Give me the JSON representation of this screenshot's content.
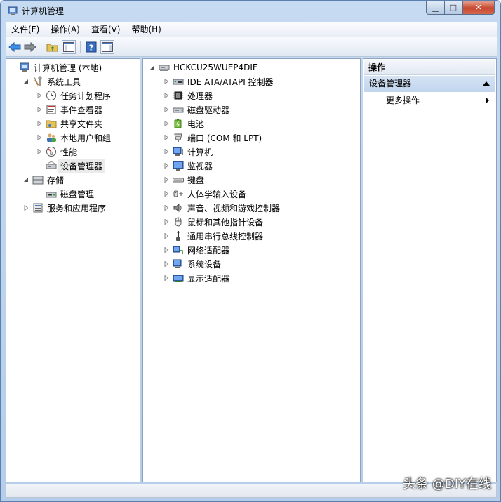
{
  "window": {
    "title": "计算机管理"
  },
  "caption": {
    "min": "▁",
    "max": "□",
    "close": "✕"
  },
  "menu": [
    "文件(F)",
    "操作(A)",
    "查看(V)",
    "帮助(H)"
  ],
  "left_tree": [
    {
      "label": "计算机管理 (本地)",
      "icon": "computer-management-icon",
      "level": 0,
      "exp": "none"
    },
    {
      "label": "系统工具",
      "icon": "tools-icon",
      "level": 1,
      "exp": "open"
    },
    {
      "label": "任务计划程序",
      "icon": "clock-icon",
      "level": 2,
      "exp": "closed"
    },
    {
      "label": "事件查看器",
      "icon": "event-viewer-icon",
      "level": 2,
      "exp": "closed"
    },
    {
      "label": "共享文件夹",
      "icon": "shared-folder-icon",
      "level": 2,
      "exp": "closed"
    },
    {
      "label": "本地用户和组",
      "icon": "users-icon",
      "level": 2,
      "exp": "closed"
    },
    {
      "label": "性能",
      "icon": "performance-icon",
      "level": 2,
      "exp": "closed"
    },
    {
      "label": "设备管理器",
      "icon": "device-manager-icon",
      "level": 2,
      "exp": "none",
      "selected": true
    },
    {
      "label": "存储",
      "icon": "storage-icon",
      "level": 1,
      "exp": "open"
    },
    {
      "label": "磁盘管理",
      "icon": "disk-management-icon",
      "level": 2,
      "exp": "none"
    },
    {
      "label": "服务和应用程序",
      "icon": "services-icon",
      "level": 1,
      "exp": "closed"
    }
  ],
  "device_root": "HCKCU25WUEP4DIF",
  "devices": [
    {
      "label": "IDE ATA/ATAPI 控制器",
      "icon": "ide-controller-icon"
    },
    {
      "label": "处理器",
      "icon": "processor-icon"
    },
    {
      "label": "磁盘驱动器",
      "icon": "disk-drive-icon"
    },
    {
      "label": "电池",
      "icon": "battery-icon"
    },
    {
      "label": "端口 (COM 和 LPT)",
      "icon": "port-icon"
    },
    {
      "label": "计算机",
      "icon": "computer-icon"
    },
    {
      "label": "监视器",
      "icon": "monitor-icon"
    },
    {
      "label": "键盘",
      "icon": "keyboard-icon"
    },
    {
      "label": "人体学输入设备",
      "icon": "hid-icon"
    },
    {
      "label": "声音、视频和游戏控制器",
      "icon": "sound-icon"
    },
    {
      "label": "鼠标和其他指针设备",
      "icon": "mouse-icon"
    },
    {
      "label": "通用串行总线控制器",
      "icon": "usb-icon"
    },
    {
      "label": "网络适配器",
      "icon": "network-adapter-icon"
    },
    {
      "label": "系统设备",
      "icon": "system-device-icon"
    },
    {
      "label": "显示适配器",
      "icon": "display-adapter-icon"
    }
  ],
  "actions": {
    "header": "操作",
    "section": "设备管理器",
    "more": "更多操作"
  },
  "watermark": "头条 @DIY在线"
}
